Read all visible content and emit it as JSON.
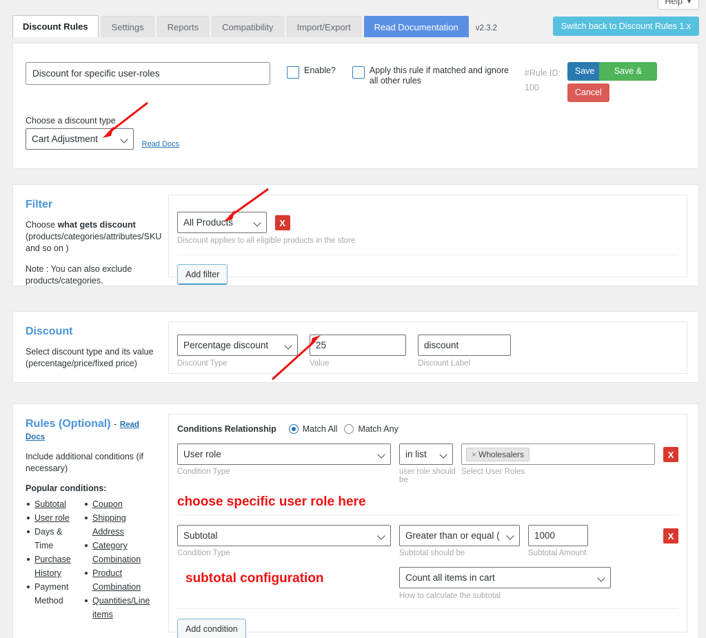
{
  "help": {
    "label": "Help",
    "caret": "▼",
    "icon": "chevron-down-icon"
  },
  "tabs": [
    {
      "label": "Discount Rules",
      "state": "active"
    },
    {
      "label": "Settings",
      "state": "inactive"
    },
    {
      "label": "Reports",
      "state": "inactive"
    },
    {
      "label": "Compatibility",
      "state": "inactive"
    },
    {
      "label": "Import/Export",
      "state": "inactive"
    },
    {
      "label": "Read Documentation",
      "state": "highlight"
    }
  ],
  "version": "v2.3.2",
  "switch_button": "Switch back to Discount Rules 1.x",
  "rule_header": {
    "title_value": "Discount for specific user-roles",
    "title_placeholder": "Discount for specific user-roles",
    "enable_label": "Enable?",
    "apply_label": "Apply this rule if matched and ignore all other rules",
    "rule_id_label": "#Rule ID:",
    "rule_id_value": "100",
    "save": "Save",
    "save_close": "Save & Close",
    "cancel": "Cancel",
    "discount_type_label": "Choose a discount type",
    "discount_type_value": "Cart Adjustment",
    "read_docs": "Read Docs"
  },
  "filter": {
    "heading": "Filter",
    "desc_1": "Choose ",
    "desc_1_bold": "what gets discount",
    "desc_1_rest": " (products/categories/attributes/SKU and so on )",
    "desc_2": "Note : You can also exclude products/categories.",
    "select_value": "All Products",
    "note": "Discount applies to all eligible products in the store",
    "add_button": "Add filter",
    "remove_icon": "X"
  },
  "discount": {
    "heading": "Discount",
    "desc": "Select discount type and its value (percentage/price/fixed price)",
    "type_value": "Percentage discount",
    "type_sublabel": "Discount Type",
    "value_value": "25",
    "value_sublabel": "Value",
    "label_value": "discount",
    "label_sublabel": "Discount Label"
  },
  "rules": {
    "heading": "Rules (Optional)",
    "heading_sep": "-",
    "read_docs": "Read Docs",
    "desc": "Include additional conditions (if necessary)",
    "popular_title": "Popular conditions:",
    "popular_col1": [
      "Subtotal",
      "User role",
      "Days & Time",
      "Purchase History",
      "Payment Method"
    ],
    "popular_col2": [
      "Coupon",
      "Shipping Address",
      "Category Combination",
      "Product Combination",
      "Quantities/Line items"
    ],
    "relationship_label": "Conditions Relationship",
    "match_all": "Match All",
    "match_any": "Match Any",
    "relationship_selected": "Match All",
    "condition_1": {
      "type_value": "User role",
      "type_sublabel": "Condition Type",
      "operator_value": "in list",
      "operator_sublabel": "user role should be",
      "tokens": [
        "Wholesalers"
      ],
      "token_remove": "×",
      "tokens_sublabel": "Select User Roles",
      "remove_icon": "X",
      "annotation": "choose specific user role here"
    },
    "condition_2": {
      "type_value": "Subtotal",
      "type_sublabel": "Condition Type",
      "operator_value": "Greater than or equal ( >= )",
      "operator_sublabel": "Subtotal should be",
      "amount_value": "1000",
      "amount_sublabel": "Subtotal Amount",
      "calc_value": "Count all items in cart",
      "calc_sublabel": "How to calculate the subtotal",
      "remove_icon": "X",
      "annotation": "subtotal configuration"
    },
    "add_button": "Add condition"
  },
  "colors": {
    "accent_blue": "#4a93d9",
    "tab_highlight": "#5b8fe4",
    "switch_cyan": "#56c0de",
    "save_blue": "#2a7ab0",
    "save_close_green": "#4fb45a",
    "cancel_red": "#db5b56",
    "remove_red": "#d9382f",
    "annotation_red": "#ee1111",
    "page_bg": "#f0f0f1"
  }
}
